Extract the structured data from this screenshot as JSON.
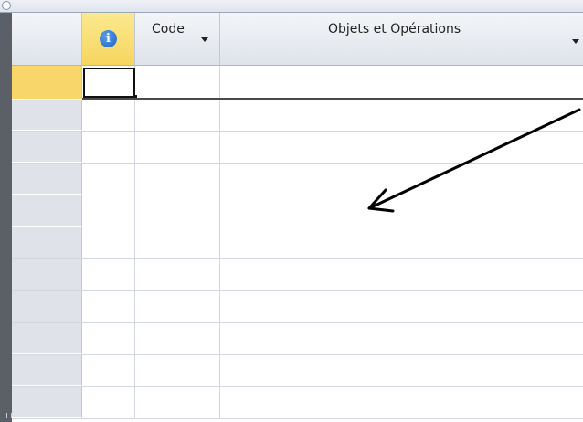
{
  "window": {
    "corner_icon": "circle-icon"
  },
  "datasheet": {
    "columns": [
      {
        "key": "info",
        "label": "",
        "icon": "info-icon",
        "icon_glyph": "i",
        "highlighted": true
      },
      {
        "key": "code",
        "label": "Code",
        "has_dropdown": true
      },
      {
        "key": "objets",
        "label": "Objets et Opérations",
        "has_dropdown": true
      }
    ],
    "new_record_row": {
      "selected": true,
      "active_column": "info"
    },
    "empty_row_count": 10
  },
  "annotation": {
    "type": "arrow",
    "color": "#000000"
  }
}
